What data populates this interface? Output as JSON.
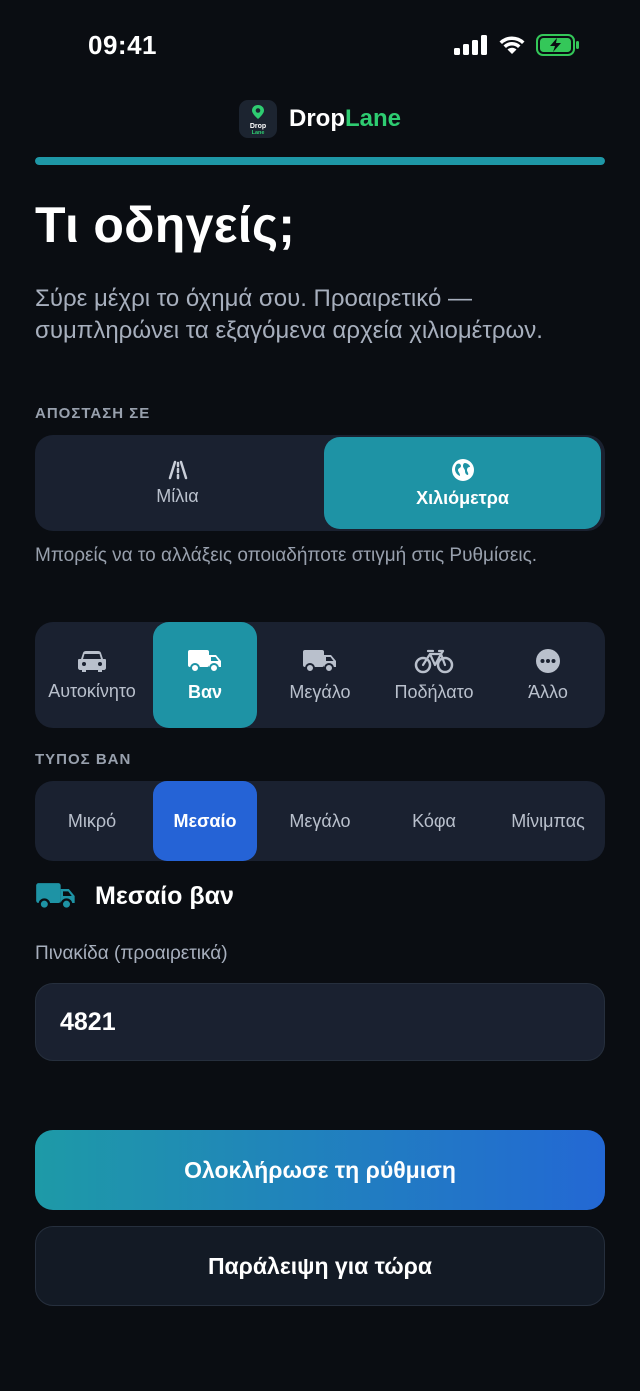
{
  "status_bar": {
    "time": "09:41",
    "icons": [
      "signal-icon",
      "wifi-icon",
      "battery-charging-icon"
    ],
    "battery_color": "#34c759"
  },
  "brand": {
    "logo_text_top": "Drop",
    "logo_text_bottom": "Lane",
    "name_part1": "Drop",
    "name_part2": "Lane",
    "accent": "#2ecc71"
  },
  "progress": {
    "value": 1.0,
    "color": "#1e97a6"
  },
  "header": {
    "title": "Τι οδηγείς;",
    "subtitle": "Σύρε μέχρι το όχημά σου. Προαιρετικό — συμπληρώνει τα εξαγόμενα αρχεία χιλιομέτρων."
  },
  "distance": {
    "label": "ΑΠΟΣΤΑΣΗ ΣΕ",
    "options": [
      {
        "label": "Μίλια",
        "icon": "road-icon",
        "active": false
      },
      {
        "label": "Χιλιόμετρα",
        "icon": "globe-icon",
        "active": true
      }
    ],
    "hint": "Μπορείς να το αλλάξεις οποιαδήποτε στιγμή στις Ρυθμίσεις."
  },
  "vehicles": {
    "options": [
      {
        "label": "Αυτοκίνητο",
        "icon": "car-icon",
        "active": false
      },
      {
        "label": "Βαν",
        "icon": "van-icon",
        "active": true
      },
      {
        "label": "Μεγάλο",
        "icon": "truck-icon",
        "active": false
      },
      {
        "label": "Ποδήλατο",
        "icon": "bicycle-icon",
        "active": false
      },
      {
        "label": "Άλλο",
        "icon": "more-icon",
        "active": false
      }
    ]
  },
  "van_type": {
    "label": "ΤΥΠΟΣ ΒΑΝ",
    "options": [
      {
        "label": "Μικρό",
        "active": false
      },
      {
        "label": "Μεσαίο",
        "active": true
      },
      {
        "label": "Μεγάλο",
        "active": false
      },
      {
        "label": "Κόφα",
        "active": false
      },
      {
        "label": "Μίνιμπας",
        "active": false
      }
    ]
  },
  "selected": {
    "label": "Μεσαίο βαν",
    "icon": "van-icon",
    "icon_color": "#1e93a5"
  },
  "plate": {
    "label": "Πινακίδα (προαιρετικά)",
    "value": "4821"
  },
  "actions": {
    "primary": "Ολοκλήρωσε τη ρύθμιση",
    "secondary": "Παράλειψη για τώρα"
  }
}
